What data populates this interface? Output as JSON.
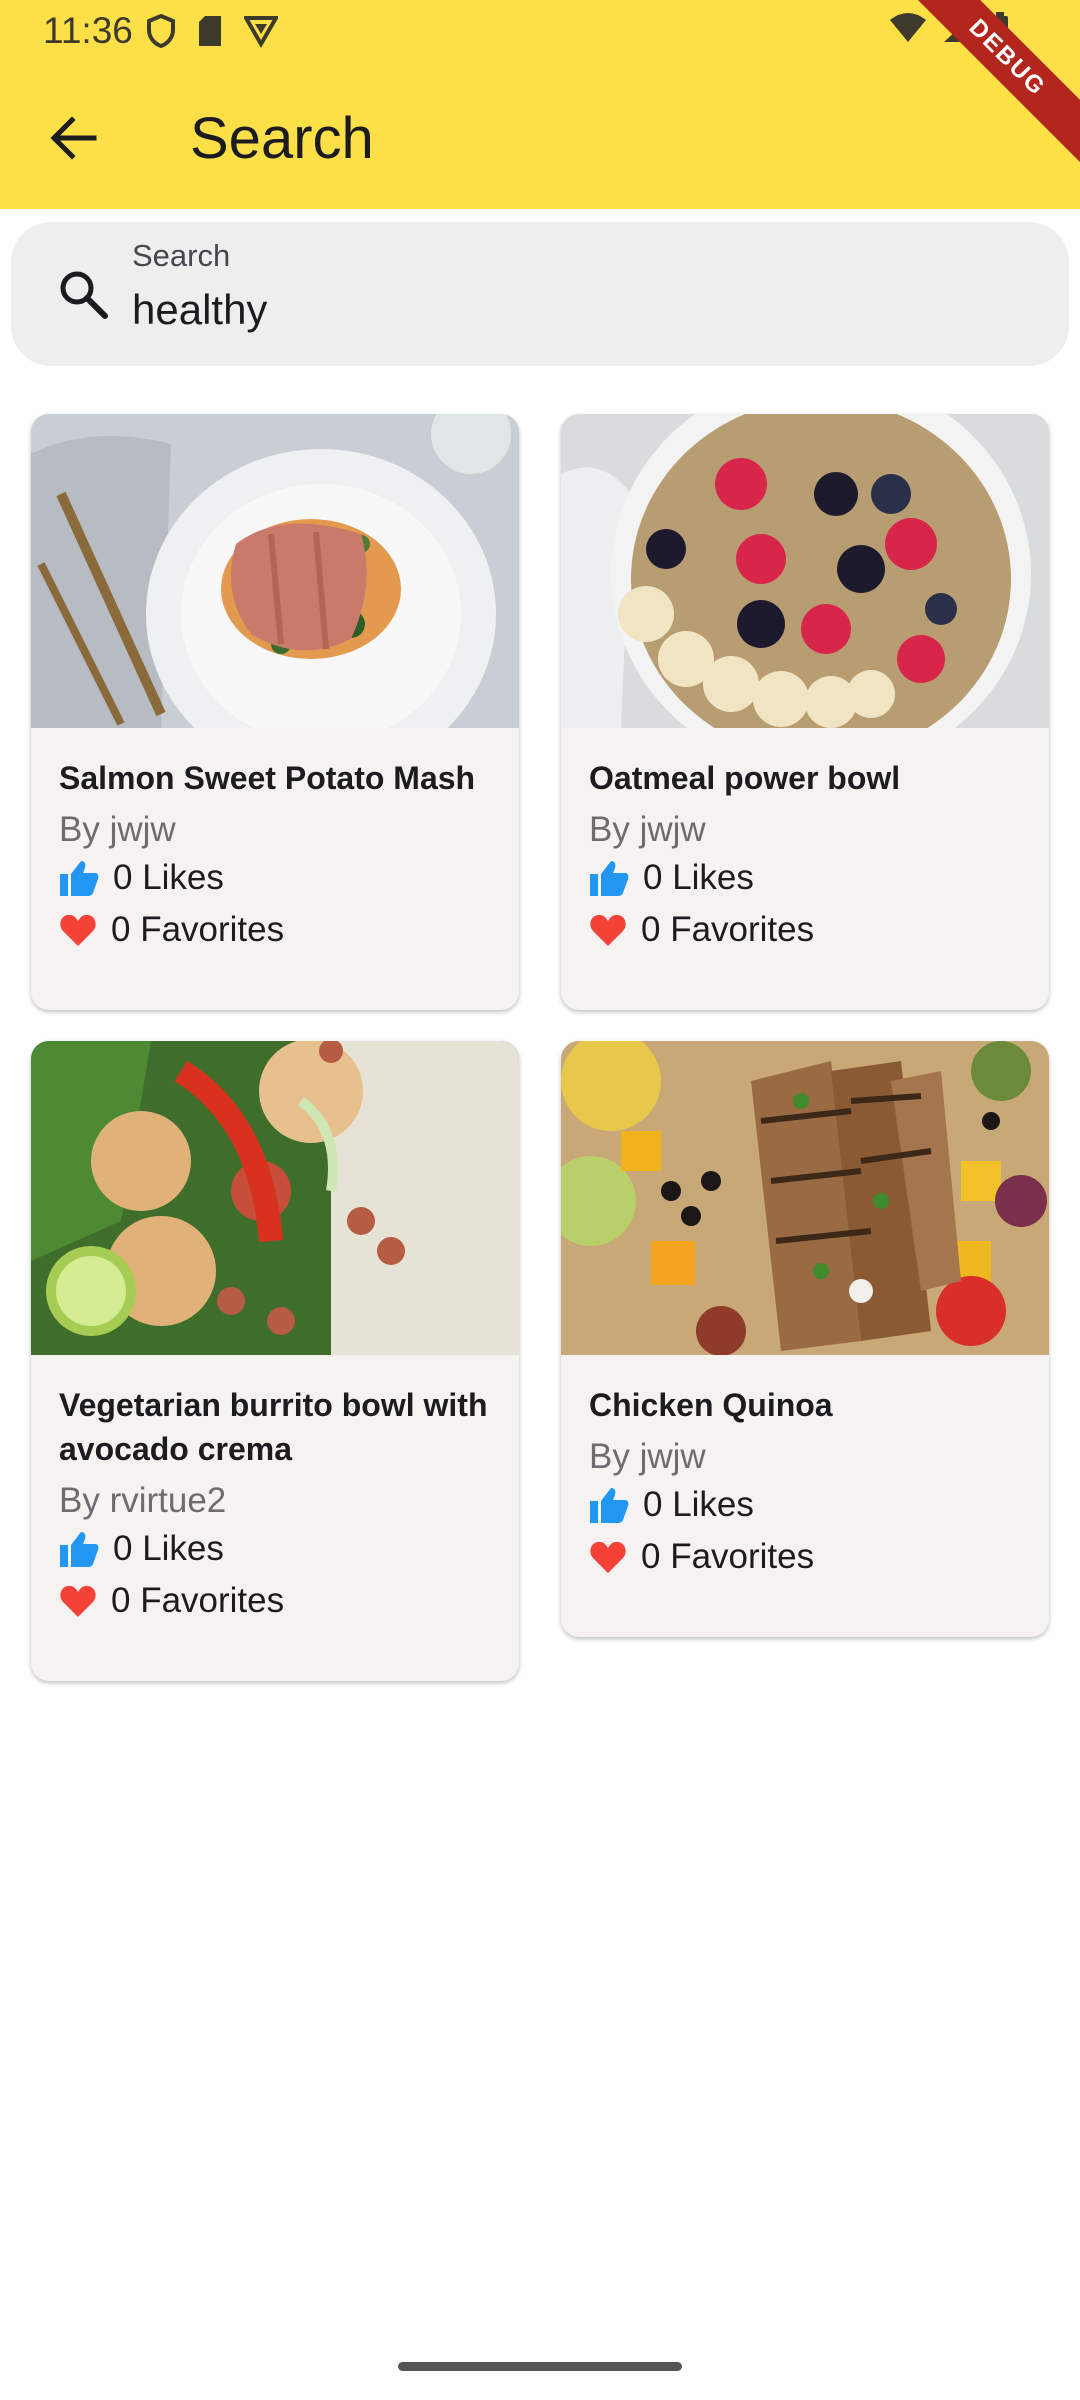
{
  "status_bar": {
    "time": "11:36"
  },
  "app_bar": {
    "title": "Search",
    "debug_label": "DEBUG"
  },
  "search": {
    "label": "Search",
    "value": "healthy"
  },
  "recipes": [
    {
      "title": "Salmon Sweet Potato Mash",
      "author": "By jwjw",
      "likes": "0 Likes",
      "favorites": "0 Favorites"
    },
    {
      "title": "Oatmeal power bowl",
      "author": "By jwjw",
      "likes": "0 Likes",
      "favorites": "0 Favorites"
    },
    {
      "title": "Vegetarian burrito bowl with avocado crema",
      "author": "By rvirtue2",
      "likes": "0 Likes",
      "favorites": "0 Favorites"
    },
    {
      "title": "Chicken Quinoa",
      "author": "By jwjw",
      "likes": "0 Likes",
      "favorites": "0 Favorites"
    }
  ],
  "colors": {
    "app_bar": "#fde047",
    "like": "#2196f3",
    "favorite": "#f44336",
    "card": "#f6f2f2"
  }
}
